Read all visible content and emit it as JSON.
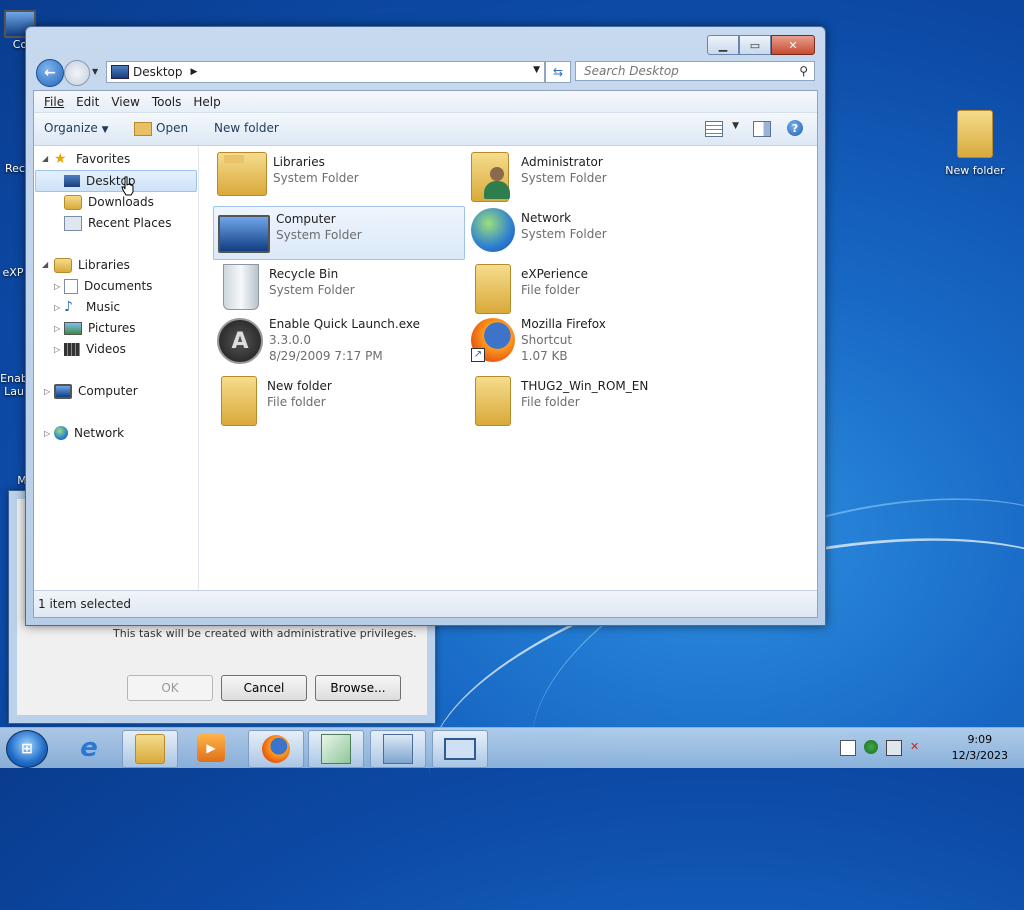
{
  "desktop": {
    "right_icon_label": "New folder",
    "left_partial": [
      "Co",
      "Rec",
      "eXP",
      "Enab",
      "Lau",
      "M"
    ]
  },
  "dialog_behind": {
    "note": "This task will be created with administrative privileges.",
    "ok": "OK",
    "cancel": "Cancel",
    "browse": "Browse..."
  },
  "window": {
    "address": "Desktop",
    "search_placeholder": "Search Desktop",
    "menu": [
      "File",
      "Edit",
      "View",
      "Tools",
      "Help"
    ],
    "commands": {
      "organize": "Organize",
      "open": "Open",
      "new_folder": "New folder"
    },
    "nav": {
      "favorites": "Favorites",
      "desktop": "Desktop",
      "downloads": "Downloads",
      "recent": "Recent Places",
      "libraries": "Libraries",
      "documents": "Documents",
      "music": "Music",
      "pictures": "Pictures",
      "videos": "Videos",
      "computer": "Computer",
      "network": "Network"
    },
    "items": [
      {
        "name": "Libraries",
        "sub": "System Folder",
        "icon": "libraries-icon"
      },
      {
        "name": "Administrator",
        "sub": "System Folder",
        "icon": "user-folder-icon"
      },
      {
        "name": "Computer",
        "sub": "System Folder",
        "icon": "computer-icon"
      },
      {
        "name": "Network",
        "sub": "System Folder",
        "icon": "network-icon"
      },
      {
        "name": "Recycle Bin",
        "sub": "System Folder",
        "icon": "recycle-bin-icon"
      },
      {
        "name": "eXPerience",
        "sub": "File folder",
        "icon": "folder-icon"
      },
      {
        "name": "Enable Quick Launch.exe",
        "sub": "3.3.0.0",
        "sub2": "8/29/2009 7:17 PM",
        "icon": "aimp-icon"
      },
      {
        "name": "Mozilla Firefox",
        "sub": "Shortcut",
        "sub2": "1.07 KB",
        "icon": "firefox-icon"
      },
      {
        "name": "New folder",
        "sub": "File folder",
        "icon": "folder-icon"
      },
      {
        "name": "THUG2_Win_ROM_EN",
        "sub": "File folder",
        "icon": "folder-icon"
      }
    ],
    "status": "1 item selected"
  },
  "taskbar": {
    "start_label": "Start",
    "time": "9:09",
    "date": "12/3/2023"
  }
}
